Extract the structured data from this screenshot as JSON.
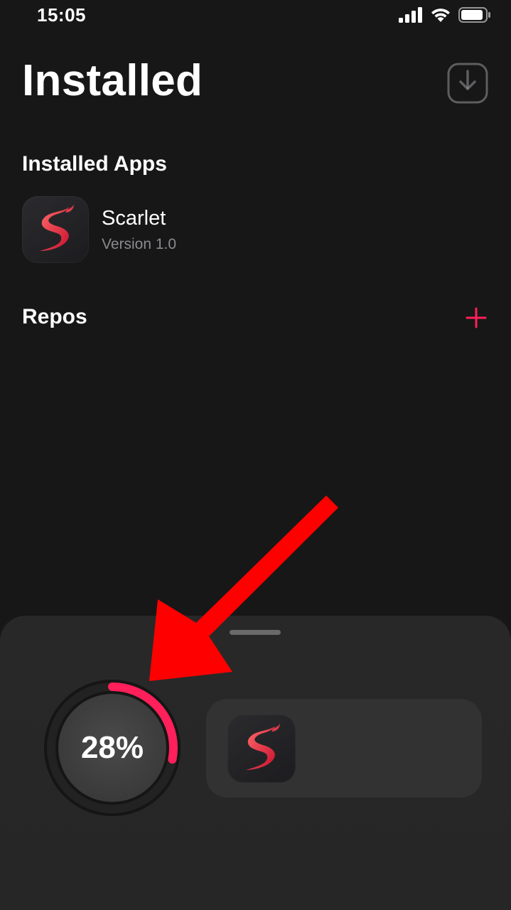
{
  "status_bar": {
    "time": "15:05",
    "icons": [
      "cellular-signal-icon",
      "wifi-icon",
      "battery-icon"
    ]
  },
  "header": {
    "title": "Installed",
    "action_icon": "download-tray-icon"
  },
  "installed_apps": {
    "section_title": "Installed Apps",
    "items": [
      {
        "name": "Scarlet",
        "version": "Version 1.0",
        "icon": "scarlet-logo-icon"
      }
    ]
  },
  "repos": {
    "section_title": "Repos",
    "add_icon": "plus-icon"
  },
  "install_queue": {
    "progress_percent": 28,
    "progress_label": "28%",
    "app_icon": "scarlet-logo-icon"
  },
  "colors": {
    "background": "#171717",
    "accent": "#ff1f5a",
    "secondary_text": "#8b8b90",
    "annotation_arrow": "#ff0000"
  }
}
